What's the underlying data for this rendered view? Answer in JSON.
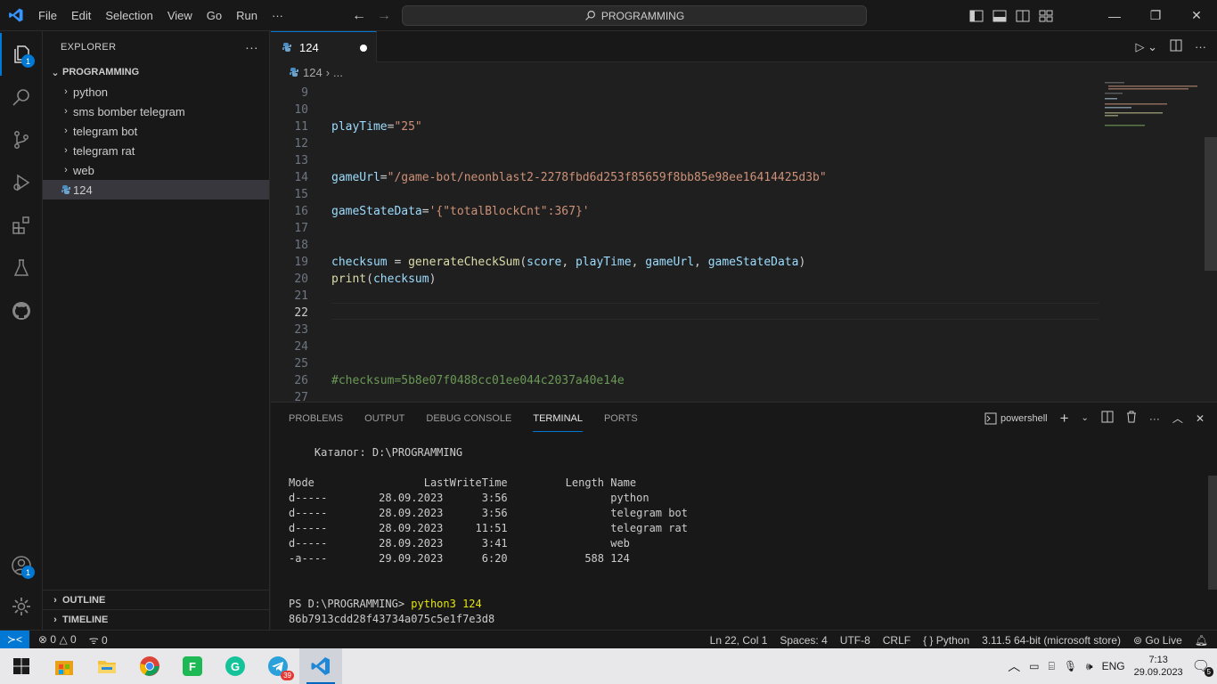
{
  "titlebar": {
    "menu": [
      "File",
      "Edit",
      "Selection",
      "View",
      "Go",
      "Run",
      "···"
    ],
    "search": "PROGRAMMING"
  },
  "activity": {
    "explorer_badge": "1",
    "accounts_badge": "1"
  },
  "sidebar": {
    "title": "EXPLORER",
    "more": "···",
    "root": "PROGRAMMING",
    "items": [
      {
        "label": "python",
        "type": "folder"
      },
      {
        "label": "sms bomber telegram",
        "type": "folder"
      },
      {
        "label": "telegram bot",
        "type": "folder"
      },
      {
        "label": "telegram rat",
        "type": "folder"
      },
      {
        "label": "web",
        "type": "folder"
      },
      {
        "label": "124",
        "type": "file"
      }
    ],
    "outline": "OUTLINE",
    "timeline": "TIMELINE"
  },
  "editor": {
    "tab": "124",
    "breadcrumb": [
      "124",
      "..."
    ],
    "lines": [
      {
        "n": "9",
        "code": ""
      },
      {
        "n": "10",
        "code": ""
      },
      {
        "n": "11",
        "code": "playTime=\"25\""
      },
      {
        "n": "12",
        "code": ""
      },
      {
        "n": "13",
        "code": ""
      },
      {
        "n": "14",
        "code": "gameUrl=\"/game-bot/neonblast2-2278fbd6d253f85659f8bb85e98ee16414425d3b\""
      },
      {
        "n": "15",
        "code": ""
      },
      {
        "n": "16",
        "code": "gameStateData='{\"totalBlockCnt\":367}'"
      },
      {
        "n": "17",
        "code": ""
      },
      {
        "n": "18",
        "code": ""
      },
      {
        "n": "19",
        "code": "checksum = generateCheckSum(score, playTime, gameUrl, gameStateData)"
      },
      {
        "n": "20",
        "code": "print(checksum)"
      },
      {
        "n": "21",
        "code": ""
      },
      {
        "n": "22",
        "code": ""
      },
      {
        "n": "23",
        "code": ""
      },
      {
        "n": "24",
        "code": ""
      },
      {
        "n": "25",
        "code": ""
      },
      {
        "n": "26",
        "code": "#checksum=5b8e07f0488cc01ee044c2037a40e14e"
      },
      {
        "n": "27",
        "code": ""
      }
    ]
  },
  "panel": {
    "tabs": [
      "PROBLEMS",
      "OUTPUT",
      "DEBUG CONSOLE",
      "TERMINAL",
      "PORTS"
    ],
    "active_tab": "TERMINAL",
    "shell": "powershell",
    "terminal_lines": [
      "    Каталог: D:\\PROGRAMMING",
      "",
      "",
      "Mode                 LastWriteTime         Length Name",
      "d-----        28.09.2023      3:56                python",
      "d-----        28.09.2023      3:56                telegram bot",
      "d-----        28.09.2023     11:51                telegram rat",
      "d-----        28.09.2023      3:41                web",
      "-a----        29.09.2023      6:20            588 124",
      "",
      "",
      "",
      ""
    ],
    "prompt": "PS D:\\PROGRAMMING> ",
    "command": "python3 124",
    "output": "86b7913cdd28f43734a075c5e1f7e3d8"
  },
  "statusbar": {
    "problems": "0",
    "warnings": "0",
    "ports": "0",
    "position": "Ln 22, Col 1",
    "spaces": "Spaces: 4",
    "encoding": "UTF-8",
    "eol": "CRLF",
    "language": "Python",
    "interpreter": "3.11.5 64-bit (microsoft store)",
    "golive": "Go Live"
  },
  "taskbar": {
    "telegram_badge": "39",
    "lang": "ENG",
    "time": "7:13",
    "date": "29.09.2023",
    "notifications": "5"
  },
  "colors": {
    "accent": "#0078d4",
    "variable": "#9cdcfe",
    "string": "#ce9178",
    "function": "#dcdcaa",
    "comment": "#6a9955"
  }
}
